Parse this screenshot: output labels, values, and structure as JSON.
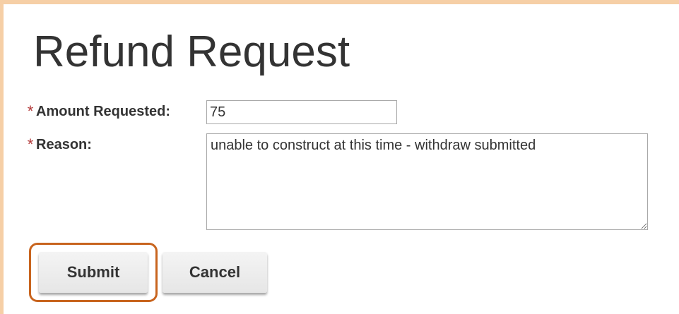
{
  "form": {
    "title": "Refund Request",
    "required_marker": "*",
    "amount": {
      "label": "Amount Requested:",
      "value": "75"
    },
    "reason": {
      "label": "Reason:",
      "value": "unable to construct at this time - withdraw submitted"
    }
  },
  "actions": {
    "submit_label": "Submit",
    "cancel_label": "Cancel"
  },
  "colors": {
    "frame_border": "#f6cfa6",
    "required_marker": "#b33a3a",
    "focus_ring": "#c8641e",
    "text": "#333333"
  }
}
